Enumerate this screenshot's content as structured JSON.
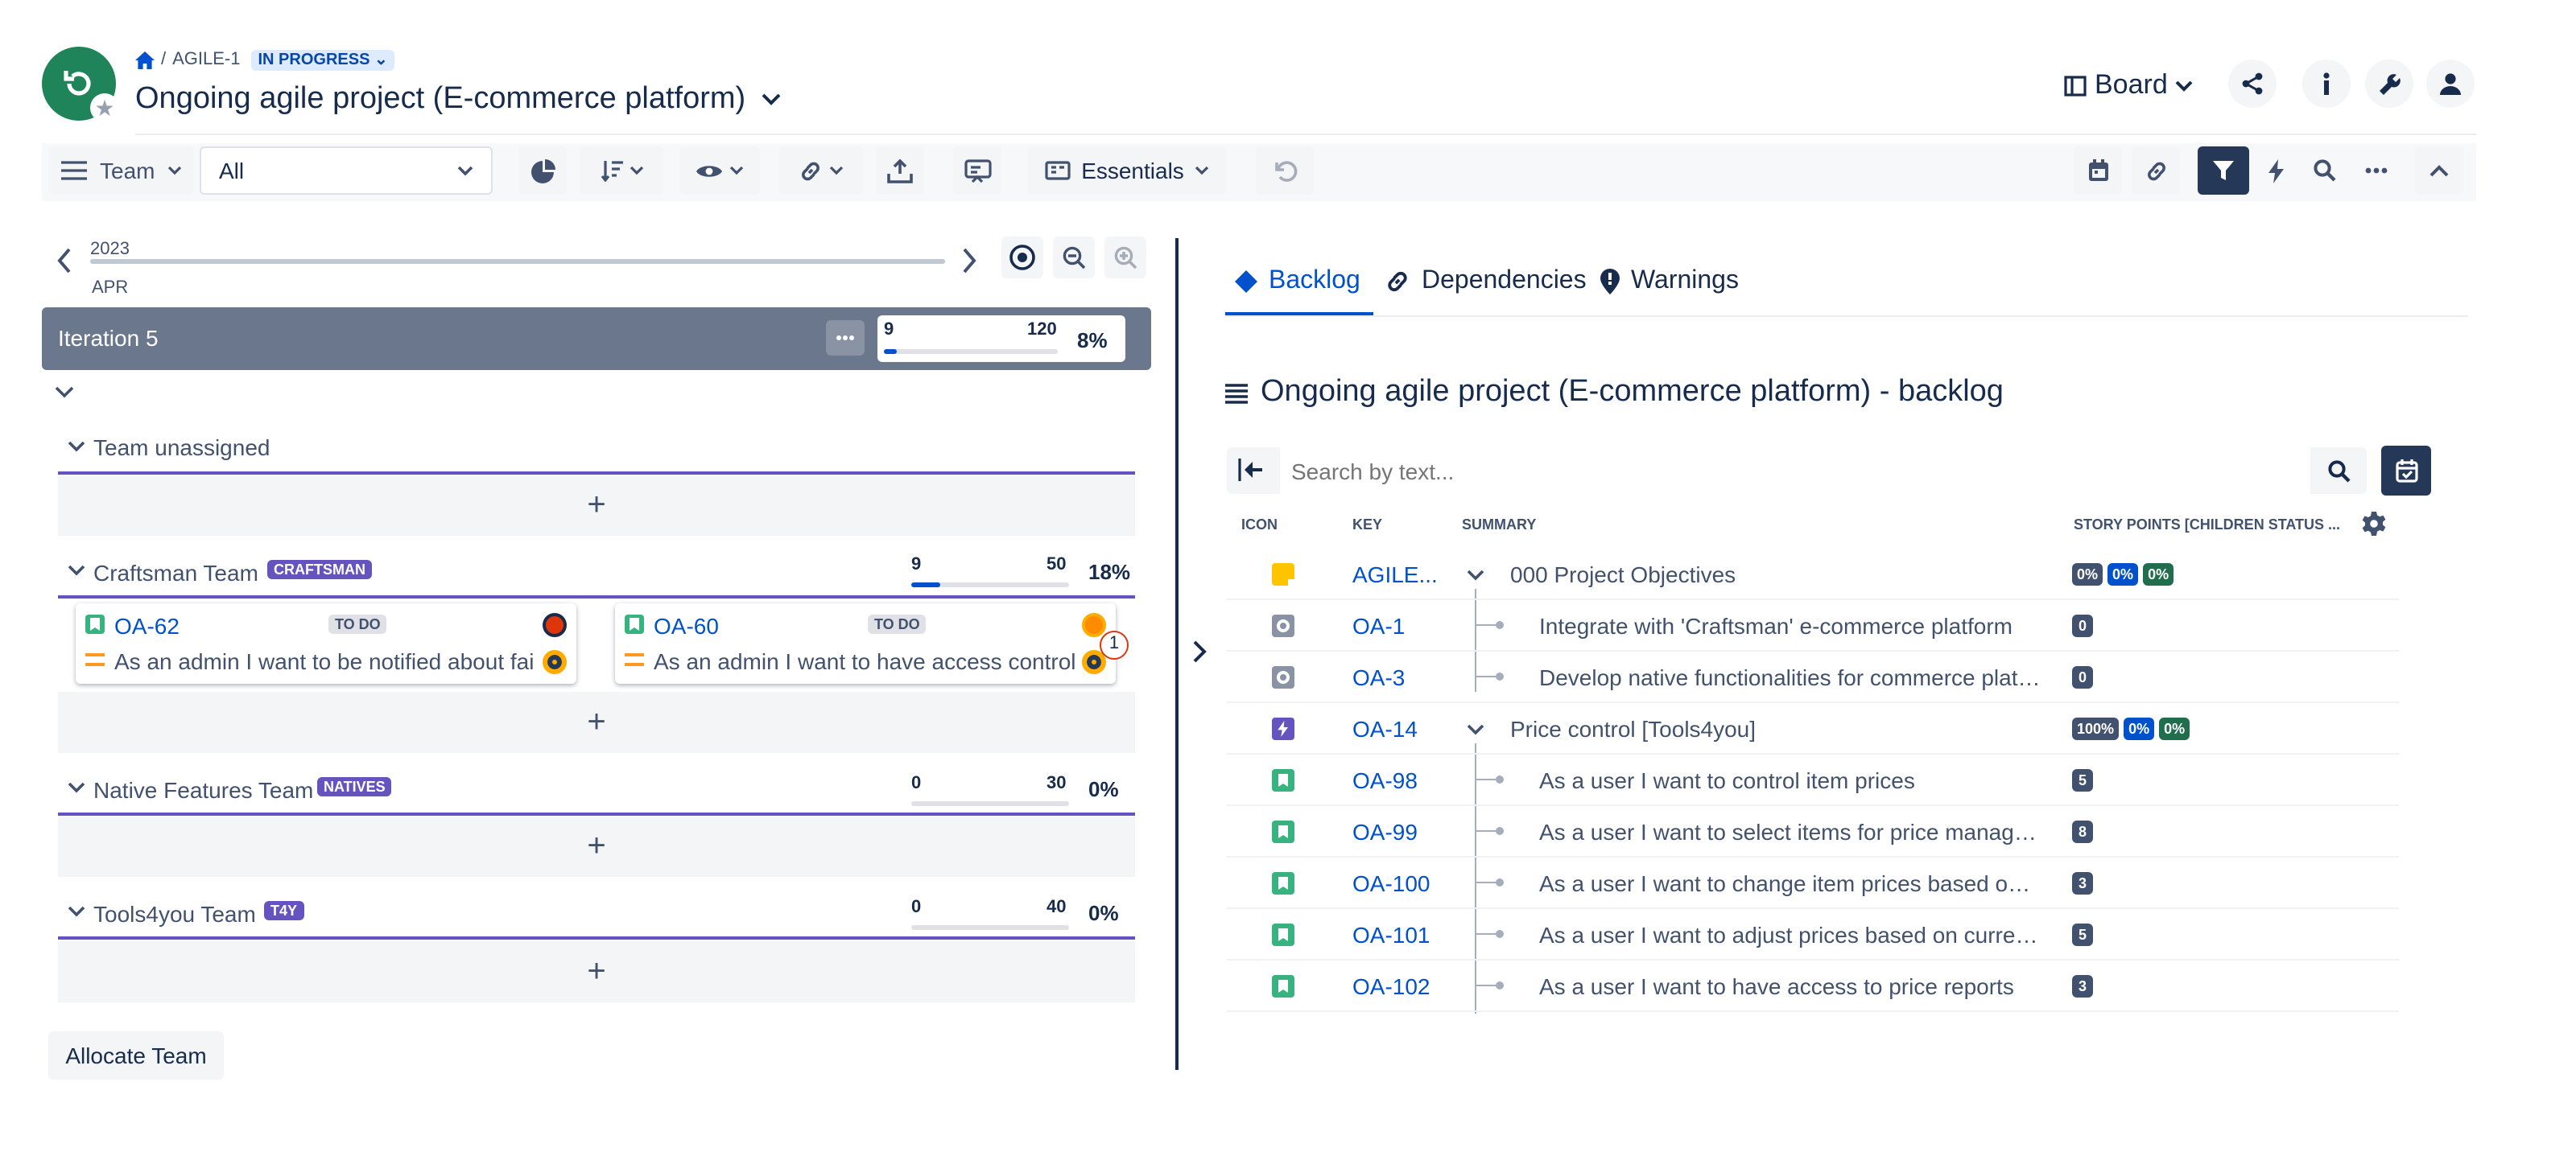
{
  "header": {
    "breadcrumb_key": "AGILE-1",
    "status": "IN PROGRESS",
    "title": "Ongoing agile project (E-commerce platform)",
    "board_label": "Board"
  },
  "toolbar": {
    "team_label": "Team",
    "team_select": "All",
    "essentials_label": "Essentials"
  },
  "timeline": {
    "year": "2023",
    "month": "APR"
  },
  "iteration": {
    "name": "Iteration 5",
    "progress_left": "9",
    "progress_right": "120",
    "percent": "8%",
    "progress_fraction": 0.075
  },
  "teams": [
    {
      "name": "Team unassigned"
    },
    {
      "name": "Craftsman Team",
      "tag": "CRAFTSMAN",
      "left": "9",
      "right": "50",
      "percent": "18%",
      "progress_fraction": 0.18
    },
    {
      "name": "Native Features Team",
      "tag": "NATIVES",
      "left": "0",
      "right": "30",
      "percent": "0%",
      "progress_fraction": 0
    },
    {
      "name": "Tools4you Team",
      "tag": "T4Y",
      "left": "0",
      "right": "40",
      "percent": "0%",
      "progress_fraction": 0
    }
  ],
  "cards": [
    {
      "key": "OA-62",
      "status": "TO DO",
      "summary": "As an admin I want to be notified about fai..."
    },
    {
      "key": "OA-60",
      "status": "TO DO",
      "summary": "As an admin I want to have access control...",
      "count": "1"
    }
  ],
  "allocate_label": "Allocate Team",
  "tabs": [
    {
      "label": "Backlog"
    },
    {
      "label": "Dependencies"
    },
    {
      "label": "Warnings"
    }
  ],
  "backlog": {
    "title": "Ongoing agile project (E-commerce platform) - backlog",
    "search_placeholder": "Search by text...",
    "columns": {
      "icon": "ICON",
      "key": "KEY",
      "summary": "SUMMARY",
      "points": "STORY POINTS [CHILDREN STATUS ..."
    },
    "rows": [
      {
        "key": "AGILE...",
        "summary": "000 Project Objectives",
        "points": [
          "0%",
          "0%",
          "0%"
        ]
      },
      {
        "key": "OA-1",
        "summary": "Integrate with 'Craftsman' e-commerce platform",
        "points": [
          "0"
        ]
      },
      {
        "key": "OA-3",
        "summary": "Develop native functionalities for commerce platfo...",
        "points": [
          "0"
        ]
      },
      {
        "key": "OA-14",
        "summary": "Price control [Tools4you]",
        "points": [
          "100%",
          "0%",
          "0%"
        ]
      },
      {
        "key": "OA-98",
        "summary": "As a user I want to control item prices",
        "points": [
          "5"
        ]
      },
      {
        "key": "OA-99",
        "summary": "As a user I want to select items for price manage...",
        "points": [
          "8"
        ]
      },
      {
        "key": "OA-100",
        "summary": "As a user I want to change item prices based on ti...",
        "points": [
          "3"
        ]
      },
      {
        "key": "OA-101",
        "summary": "As a user I want to adjust prices based on currenc...",
        "points": [
          "5"
        ]
      },
      {
        "key": "OA-102",
        "summary": "As a user I want to have access to price reports",
        "points": [
          "3"
        ]
      }
    ]
  },
  "colors": {
    "accent": "#0052cc",
    "team_line": "#6554c0",
    "iteration_bg": "#6b778c",
    "done_green": "#216e4e"
  }
}
